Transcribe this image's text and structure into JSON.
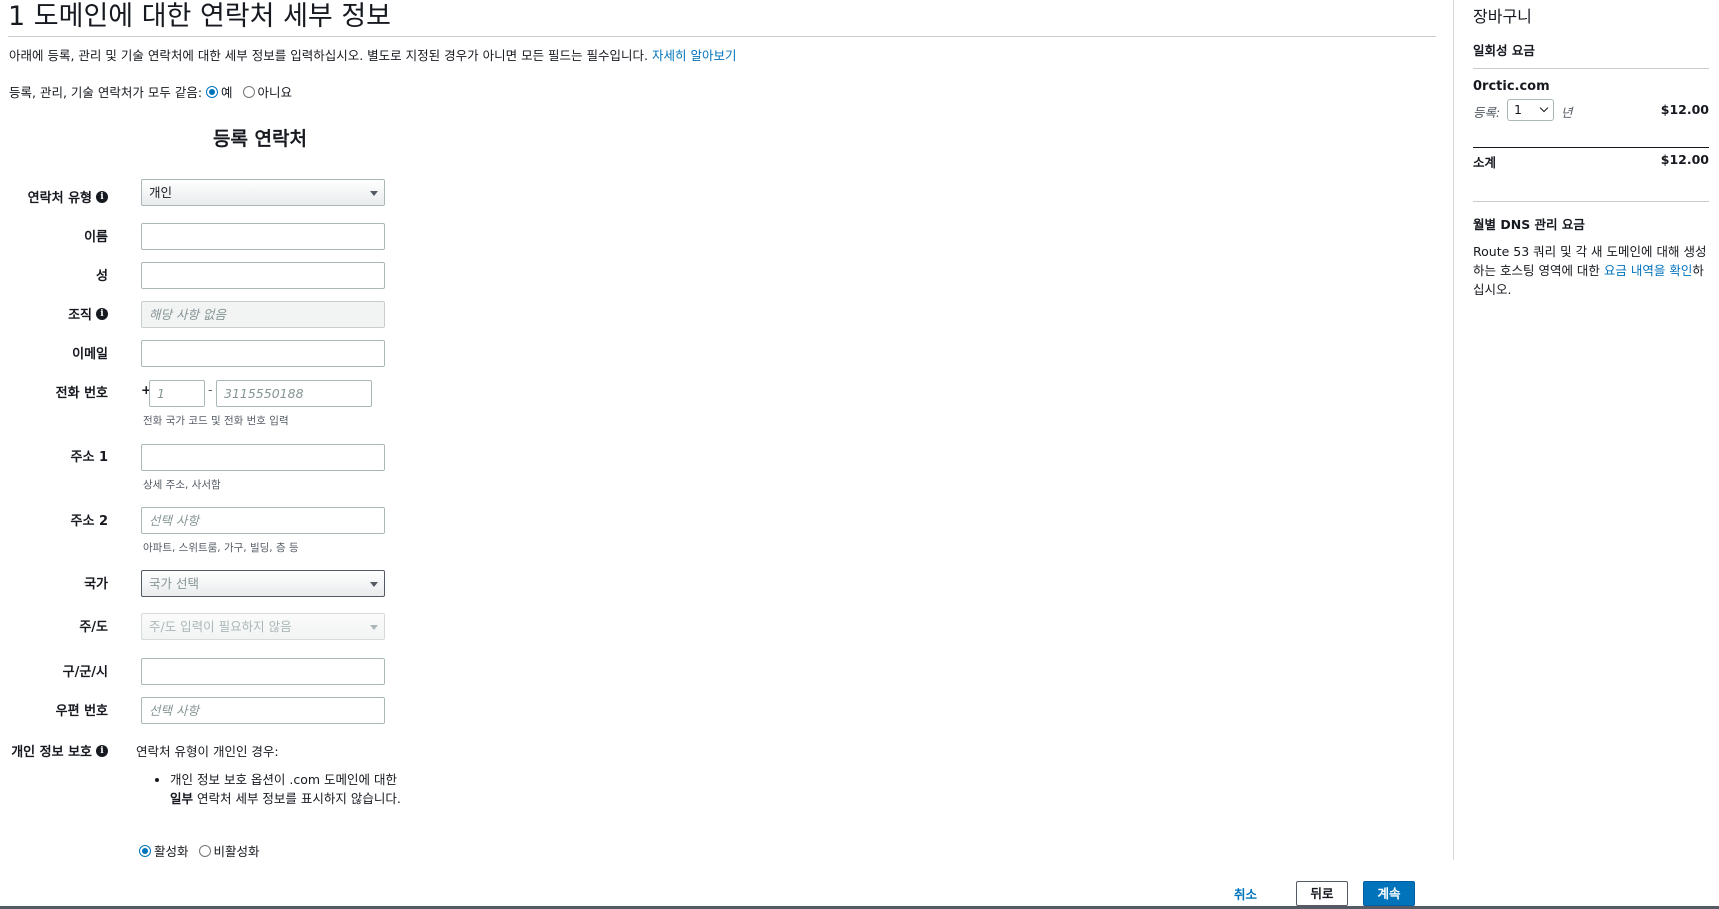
{
  "header": {
    "title": "1 도메인에 대한 연락처 세부 정보",
    "intro": "아래에 등록, 관리 및 기술 연락처에 대한 세부 정보를 입력하십시오. 별도로 지정된 경우가 아니면 모든 필드는 필수입니다.",
    "learn_more": "자세히 알아보기",
    "same_contacts_label": "등록, 관리, 기술 연락처가 모두 같음:",
    "same_yes": "예",
    "same_no": "아니요"
  },
  "form": {
    "section_title": "등록 연락처",
    "contact_type": {
      "label": "연락처 유형",
      "value": "개인"
    },
    "first_name": {
      "label": "이름",
      "value": ""
    },
    "last_name": {
      "label": "성",
      "value": ""
    },
    "organization": {
      "label": "조직",
      "placeholder": "해당 사항 없음"
    },
    "email": {
      "label": "이메일",
      "value": ""
    },
    "phone": {
      "label": "전화 번호",
      "plus": "+",
      "sep": "-",
      "code_placeholder": "1",
      "number_placeholder": "3115550188",
      "help": "전화 국가 코드 및 전화 번호 입력"
    },
    "address1": {
      "label": "주소 1",
      "value": "",
      "help": "상세 주소, 사서함"
    },
    "address2": {
      "label": "주소 2",
      "placeholder": "선택 사항",
      "help": "아파트, 스위트룸, 가구, 빌딩, 층 등"
    },
    "country": {
      "label": "국가",
      "value": "국가 선택"
    },
    "state": {
      "label": "주/도",
      "value": "주/도 입력이 필요하지 않음"
    },
    "city": {
      "label": "구/군/시",
      "value": ""
    },
    "postal": {
      "label": "우편 번호",
      "placeholder": "선택 사항"
    },
    "privacy": {
      "label": "개인 정보 보호",
      "text": "연락처 유형이 개인인 경우:",
      "bullet_part1": "개인 정보 보호 옵션이 .com 도메인에 대한 ",
      "bullet_bold": "일부",
      "bullet_part2": " 연락처 세부 정보를 표시하지 않습니다.",
      "enable": "활성화",
      "disable": "비활성화"
    }
  },
  "cart": {
    "title": "장바구니",
    "onetime_fee": "일회성 요금",
    "domain": "0rctic.com",
    "reg_label": "등록:",
    "reg_years": "1",
    "year_label": "년",
    "reg_price": "$12.00",
    "subtotal_label": "소계",
    "subtotal_price": "$12.00",
    "dns_title": "월별 DNS 관리 요금",
    "dns_desc_part1": "Route 53 쿼리 및 각 새 도메인에 대해 생성하는 호스팅 영역에 대한 ",
    "dns_desc_link": "요금 내역을 확인",
    "dns_desc_part2": "하십시오."
  },
  "footer": {
    "cancel": "취소",
    "back": "뒤로",
    "continue": "계속"
  }
}
